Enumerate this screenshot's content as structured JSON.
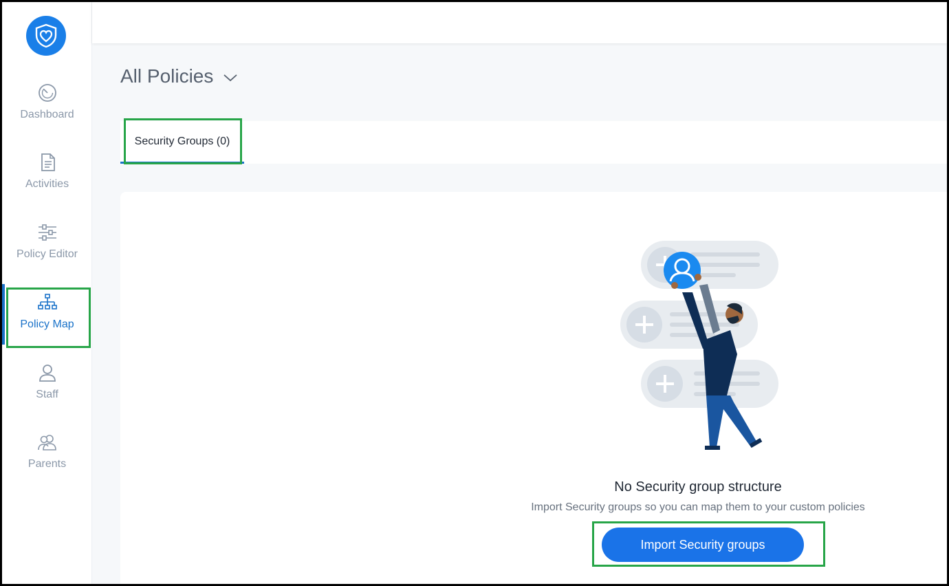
{
  "sidebar": {
    "items": [
      {
        "label": "Dashboard",
        "icon": "speedometer-icon"
      },
      {
        "label": "Activities",
        "icon": "document-icon"
      },
      {
        "label": "Policy Editor",
        "icon": "sliders-icon"
      },
      {
        "label": "Policy Map",
        "icon": "sitemap-icon",
        "active": true
      },
      {
        "label": "Staff",
        "icon": "person-icon"
      },
      {
        "label": "Parents",
        "icon": "people-icon"
      }
    ]
  },
  "header": {
    "title": "All Policies"
  },
  "tabs": [
    {
      "label": "Security Groups (0)"
    }
  ],
  "empty_state": {
    "title": "No Security group structure",
    "subtitle": "Import Security groups so you can map them to your custom policies",
    "button_label": "Import Security groups"
  },
  "colors": {
    "accent": "#1a73e8",
    "highlight": "#27a548",
    "nav_inactive": "#8a97a8",
    "nav_active": "#1a72c9"
  }
}
